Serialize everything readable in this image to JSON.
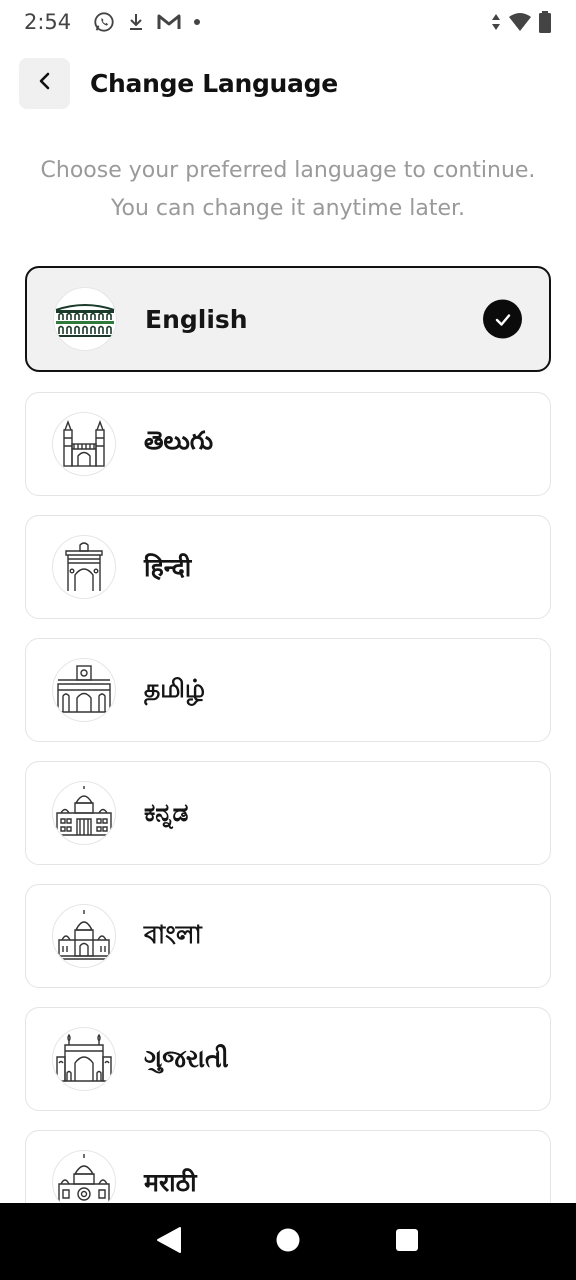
{
  "status_bar": {
    "time": "2:54",
    "icons": [
      "whatsapp-icon",
      "download-icon",
      "gmail-icon",
      "dot-icon",
      "data-arrows-icon",
      "wifi-icon",
      "battery-icon"
    ]
  },
  "header": {
    "title": "Change Language",
    "back_icon": "chevron-left-icon"
  },
  "subtitle": "Choose your preferred language to continue. You can change it anytime later.",
  "languages": [
    {
      "label": "English",
      "icon": "colosseum-icon",
      "selected": true
    },
    {
      "label": "తెలుగు",
      "icon": "charminar-icon",
      "selected": false
    },
    {
      "label": "हिन्दी",
      "icon": "india-gate-icon",
      "selected": false
    },
    {
      "label": "தமிழ்",
      "icon": "chennai-central-icon",
      "selected": false
    },
    {
      "label": "ಕನ್ನಡ",
      "icon": "vidhana-soudha-icon",
      "selected": false
    },
    {
      "label": "বাংলা",
      "icon": "victoria-memorial-icon",
      "selected": false
    },
    {
      "label": "ગુજરાતી",
      "icon": "gateway-of-india-icon",
      "selected": false
    },
    {
      "label": "मराठी",
      "icon": "csmt-icon",
      "selected": false
    }
  ],
  "nav_bar": {
    "icons": [
      "back-triangle-icon",
      "home-circle-icon",
      "recents-square-icon"
    ]
  },
  "colors": {
    "selected_border": "#111111",
    "selected_bg": "#f1f1f1",
    "card_border": "#e4e4e4",
    "subtitle": "#9a9a9a"
  }
}
